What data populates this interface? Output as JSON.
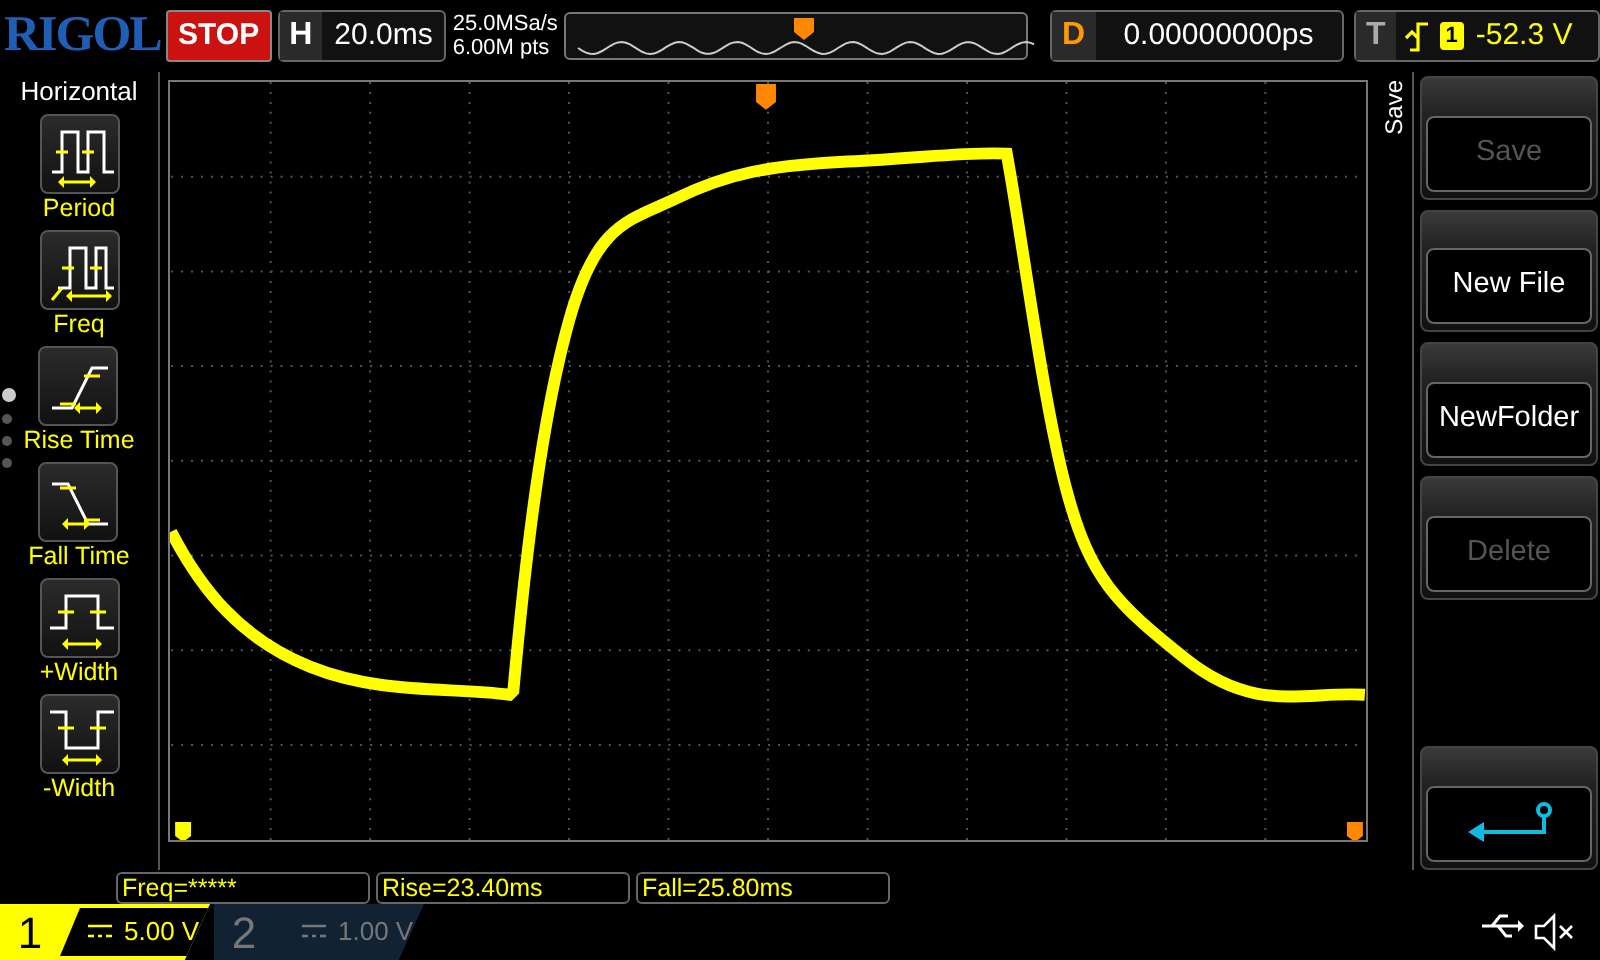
{
  "top_bar": {
    "logo": "RIGOL",
    "run_state": "STOP",
    "horizontal": {
      "label": "H",
      "timebase": "20.0ms"
    },
    "sample_rate": "25.0MSa/s",
    "memory_depth": "6.00M pts",
    "delay": {
      "label": "D",
      "value": "0.00000000ps"
    },
    "trigger": {
      "label": "T",
      "source": "1",
      "level": "-52.3 V"
    }
  },
  "left_menu": {
    "title": "Horizontal",
    "items": [
      {
        "kind": "period",
        "label": "Period"
      },
      {
        "kind": "freq",
        "label": "Freq"
      },
      {
        "kind": "rise",
        "label": "Rise Time"
      },
      {
        "kind": "fall",
        "label": "Fall Time"
      },
      {
        "kind": "pwidth",
        "label": "+Width"
      },
      {
        "kind": "nwidth",
        "label": "-Width"
      }
    ],
    "page_dots": [
      {
        "selected": true
      },
      {
        "selected": false
      },
      {
        "selected": false
      },
      {
        "selected": false
      }
    ]
  },
  "right_menu": {
    "title": "Save",
    "buttons": [
      {
        "kind": "text",
        "label": "Save",
        "disabled": true
      },
      {
        "kind": "text",
        "label": "New File",
        "disabled": false
      },
      {
        "kind": "text",
        "label": "NewFolder",
        "disabled": false
      },
      {
        "kind": "text",
        "label": "Delete",
        "disabled": true
      },
      {
        "kind": "back"
      }
    ]
  },
  "measurements": [
    "Freq=*****",
    "Rise=23.40ms",
    "Fall=25.80ms"
  ],
  "channels": [
    {
      "number": "1",
      "scale": "5.00 V",
      "on": true
    },
    {
      "number": "2",
      "scale": "1.00 V",
      "on": false
    }
  ]
}
